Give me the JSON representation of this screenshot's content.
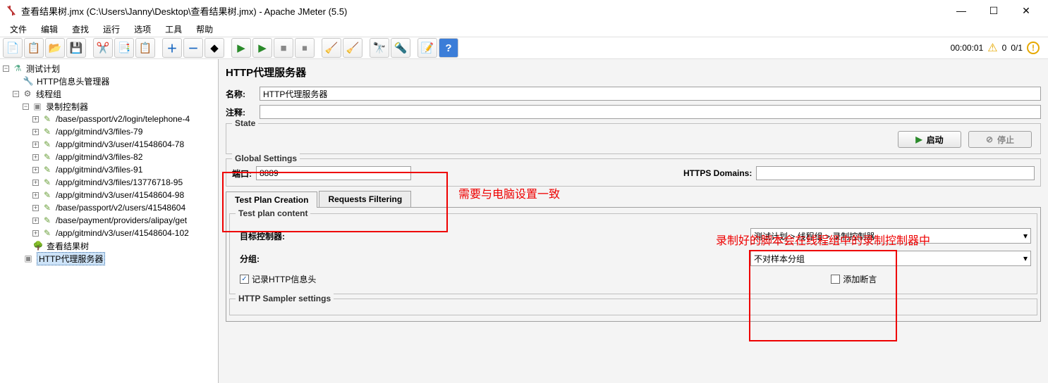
{
  "title": "查看结果树.jmx (C:\\Users\\Janny\\Desktop\\查看结果树.jmx) - Apache JMeter (5.5)",
  "menu": {
    "file": "文件",
    "edit": "编辑",
    "search": "查找",
    "run": "运行",
    "options": "选项",
    "tools": "工具",
    "help": "帮助"
  },
  "status": {
    "time": "00:00:01",
    "threads": "0",
    "total": "0/1"
  },
  "tree": {
    "root": "测试计划",
    "headerManager": "HTTP信息头管理器",
    "threadGroup": "线程组",
    "recorder": "录制控制器",
    "samplers": [
      "/base/passport/v2/login/telephone-4",
      "/app/gitmind/v3/files-79",
      "/app/gitmind/v3/user/41548604-78",
      "/app/gitmind/v3/files-82",
      "/app/gitmind/v3/files-91",
      "/app/gitmind/v3/files/13776718-95",
      "/app/gitmind/v3/user/41548604-98",
      "/base/passport/v2/users/41548604",
      "/base/payment/providers/alipay/get",
      "/app/gitmind/v3/user/41548604-102"
    ],
    "viewResults": "查看结果树",
    "proxy": "HTTP代理服务器"
  },
  "panel": {
    "heading": "HTTP代理服务器",
    "nameLabel": "名称:",
    "nameValue": "HTTP代理服务器",
    "commentLabel": "注释:",
    "commentValue": "",
    "stateLegend": "State",
    "startLabel": "启动",
    "stopLabel": "停止",
    "globalLegend": "Global Settings",
    "portLabel": "端口:",
    "portValue": "8889",
    "httpsLabel": "HTTPS Domains:",
    "httpsValue": "",
    "tab1": "Test Plan Creation",
    "tab2": "Requests Filtering",
    "tpLegend": "Test plan content",
    "targetLabel": "目标控制器:",
    "targetValue": "测试计划 > 线程组 > 录制控制器",
    "groupLabel": "分组:",
    "groupValue": "不对样本分组",
    "chkRecord": "记录HTTP信息头",
    "chkAssert": "添加断言",
    "samplerLegend": "HTTP Sampler settings"
  },
  "annot": {
    "red1": "需要与电脑设置一致",
    "red2": "录制好的脚本会在线程组中的录制控制器中"
  }
}
